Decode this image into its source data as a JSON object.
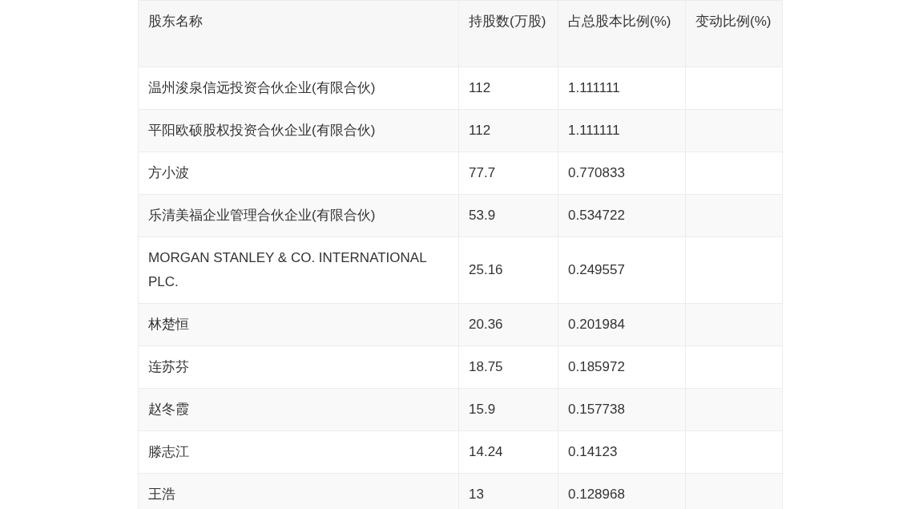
{
  "table": {
    "columns": [
      "股东名称",
      "持股数(万股)",
      "占总股本比例(%)",
      "变动比例(%)"
    ],
    "rows": [
      {
        "name": "温州浚泉信远投资合伙企业(有限合伙)",
        "shares": "112",
        "ratio": "1.111111"
      },
      {
        "name": "平阳欧硕股权投资合伙企业(有限合伙)",
        "shares": "112",
        "ratio": "1.111111"
      },
      {
        "name": "方小波",
        "shares": "77.7",
        "ratio": "0.770833"
      },
      {
        "name": "乐清美福企业管理合伙企业(有限合伙)",
        "shares": "53.9",
        "ratio": "0.534722"
      },
      {
        "name": "MORGAN STANLEY & CO. INTERNATIONAL PLC.",
        "shares": "25.16",
        "ratio": "0.249557"
      },
      {
        "name": "林楚恒",
        "shares": "20.36",
        "ratio": "0.201984"
      },
      {
        "name": "连苏芬",
        "shares": "18.75",
        "ratio": "0.185972"
      },
      {
        "name": "赵冬霞",
        "shares": "15.9",
        "ratio": "0.157738"
      },
      {
        "name": "滕志江",
        "shares": "14.24",
        "ratio": "0.14123"
      },
      {
        "name": "王浩",
        "shares": "13",
        "ratio": "0.128968"
      }
    ]
  }
}
